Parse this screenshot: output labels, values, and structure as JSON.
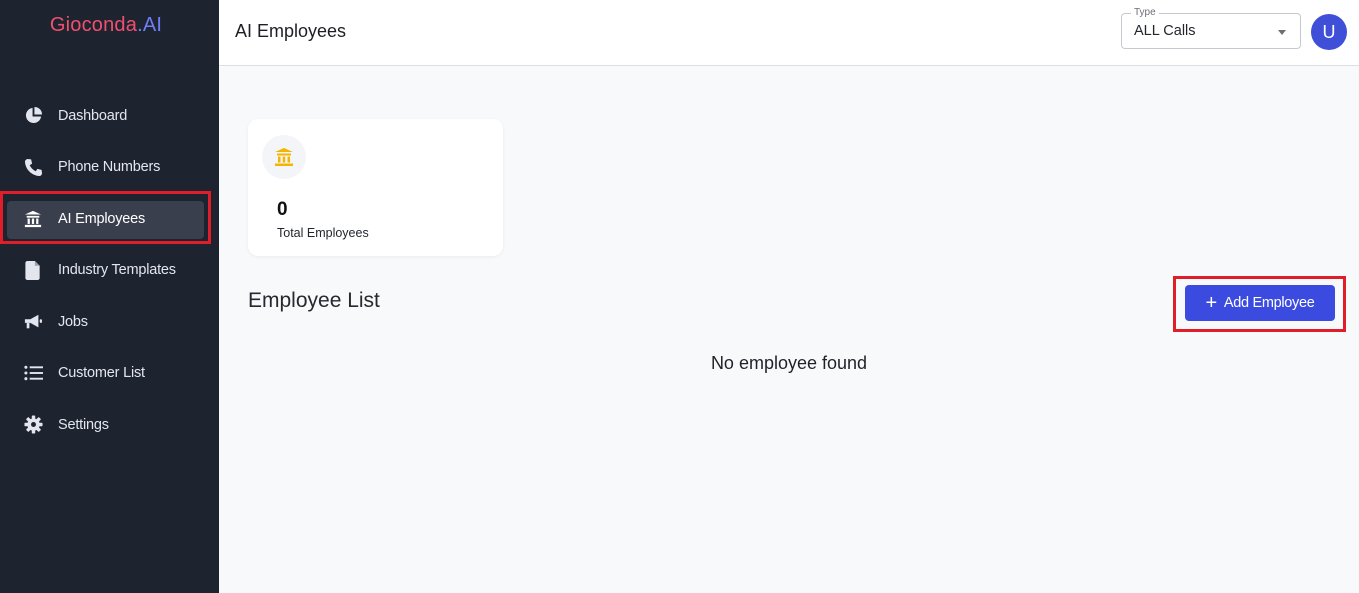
{
  "brand": {
    "name_part1": "Gioconda",
    "name_part2": ".AI"
  },
  "sidebar": {
    "items": [
      {
        "label": "Dashboard",
        "icon": "pie-chart-icon",
        "active": false
      },
      {
        "label": "Phone Numbers",
        "icon": "phone-icon",
        "active": false
      },
      {
        "label": "AI Employees",
        "icon": "employee-building-icon",
        "active": true
      },
      {
        "label": "Industry Templates",
        "icon": "file-icon",
        "active": false
      },
      {
        "label": "Jobs",
        "icon": "megaphone-icon",
        "active": false
      },
      {
        "label": "Customer List",
        "icon": "list-icon",
        "active": false
      },
      {
        "label": "Settings",
        "icon": "gear-icon",
        "active": false
      }
    ]
  },
  "header": {
    "title": "AI Employees",
    "type_select": {
      "legend": "Type",
      "value": "ALL Calls"
    },
    "avatar_initial": "U"
  },
  "stats": {
    "value": "0",
    "label": "Total Employees",
    "icon": "employee-building-icon"
  },
  "main": {
    "section_title": "Employee List",
    "add_button_label": "Add Employee",
    "empty_message": "No employee found"
  },
  "colors": {
    "sidebar_bg": "#1e2330",
    "accent": "#3b4be0",
    "highlight": "#e01e2a",
    "icon_yellow": "#f4b400"
  }
}
